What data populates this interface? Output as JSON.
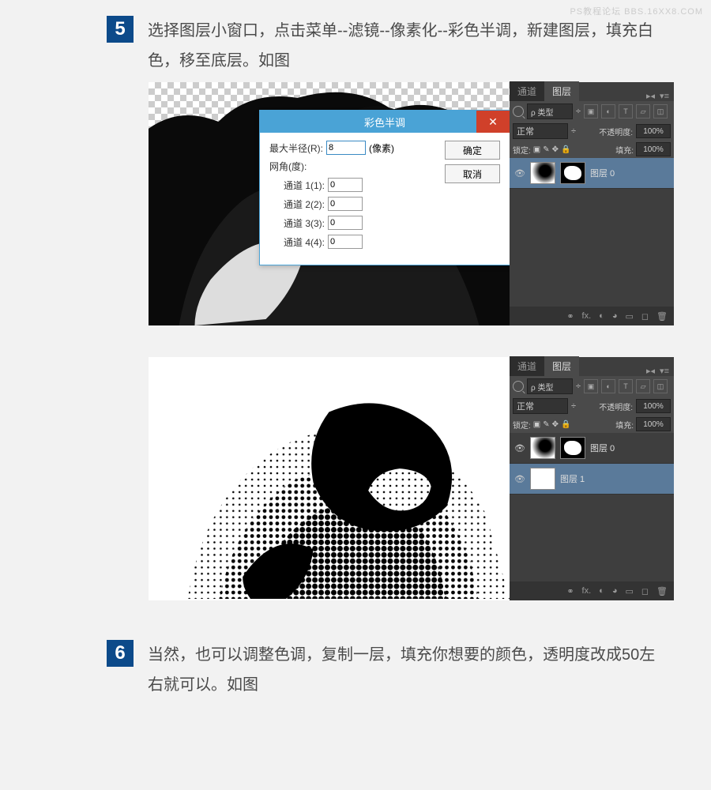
{
  "watermark": "PS教程论坛  BBS.16XX8.COM",
  "step5": {
    "num": "5",
    "text": "选择图层小窗口，点击菜单--滤镜--像素化--彩色半调，新建图层，填充白色，移至底层。如图"
  },
  "dialog": {
    "title": "彩色半调",
    "max_radius_label": "最大半径(R):",
    "max_radius_value": "8",
    "pixels": "(像素)",
    "angle_header": "网角(度):",
    "ch1_label": "通道 1(1):",
    "ch1_val": "0",
    "ch2_label": "通道 2(2):",
    "ch2_val": "0",
    "ch3_label": "通道 3(3):",
    "ch3_val": "0",
    "ch4_label": "通道 4(4):",
    "ch4_val": "0",
    "ok": "确定",
    "cancel": "取消"
  },
  "panel_a": {
    "tab_channels": "通道",
    "tab_layers": "图层",
    "kind_label": "ρ 类型",
    "blend_mode": "正常",
    "opacity_label": "不透明度:",
    "opacity_val": "100%",
    "lock_label": "锁定:",
    "fill_label": "填充:",
    "fill_val": "100%",
    "layer0": "图层 0"
  },
  "panel_b": {
    "tab_channels": "通道",
    "tab_layers": "图层",
    "kind_label": "ρ 类型",
    "blend_mode": "正常",
    "opacity_label": "不透明度:",
    "opacity_val": "100%",
    "lock_label": "锁定:",
    "fill_label": "填充:",
    "fill_val": "100%",
    "layer0": "图层 0",
    "layer1": "图层 1"
  },
  "step6": {
    "num": "6",
    "text": "当然，也可以调整色调，复制一层，填充你想要的颜色，透明度改成50左右就可以。如图"
  },
  "icons": {
    "eye": "👁",
    "fx": "fx.",
    "mask_icon": "◐",
    "adjust_icon": "◕",
    "folder_icon": "▭",
    "new_icon": "◻",
    "trash_icon": "🗑",
    "link_icon": "⚭",
    "arrows": "▸◂",
    "menu": "▾≡",
    "chevron": "÷",
    "img_icon": "▣",
    "adj_icon": "◐",
    "t_icon": "T",
    "shape_icon": "▱",
    "smart_icon": "◫",
    "lock_img": "▣",
    "lock_pos": "✥",
    "lock_all": "🔒",
    "lock_brush": "✎"
  }
}
